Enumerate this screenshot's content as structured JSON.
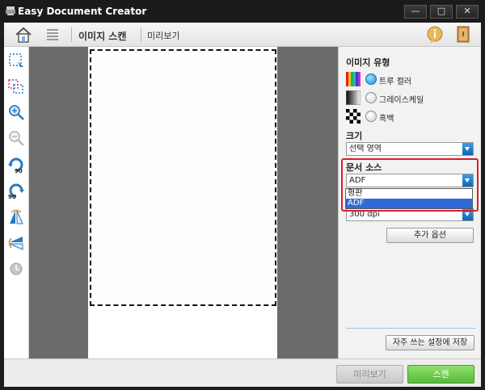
{
  "window": {
    "title": "Easy Document Creator",
    "minimize_glyph": "—",
    "maximize_glyph": "□",
    "close_glyph": "✕"
  },
  "toolbar": {
    "scan_image_label": "이미지 스캔",
    "preview_label": "미리보기"
  },
  "tools": [
    "select-area-icon",
    "multi-select-icon",
    "zoom-in-icon",
    "zoom-out-icon",
    "rotate-left-90-icon",
    "rotate-right-90-icon",
    "flip-horizontal-icon",
    "flip-vertical-icon",
    "reset-icon"
  ],
  "panel": {
    "image_type": {
      "title": "이미지 유형",
      "options": [
        {
          "label": "트루 컬러",
          "checked": true
        },
        {
          "label": "그레이스케일",
          "checked": false
        },
        {
          "label": "흑백",
          "checked": false
        }
      ]
    },
    "size": {
      "title": "크기",
      "value": "선택 영역"
    },
    "document_source": {
      "title": "문서 소스",
      "value": "ADF",
      "options": [
        "평판",
        "ADF"
      ],
      "selected_option": "ADF"
    },
    "resolution": {
      "value": "300 dpi"
    },
    "more_options_label": "추가 옵션",
    "save_settings_label": "자주 쓰는 설정에 저장"
  },
  "footer": {
    "preview_label": "미리보기",
    "scan_label": "스캔"
  },
  "colors": {
    "accent_blue": "#2f6bd6",
    "scan_green": "#58b93a",
    "highlight_red": "#d32028"
  }
}
